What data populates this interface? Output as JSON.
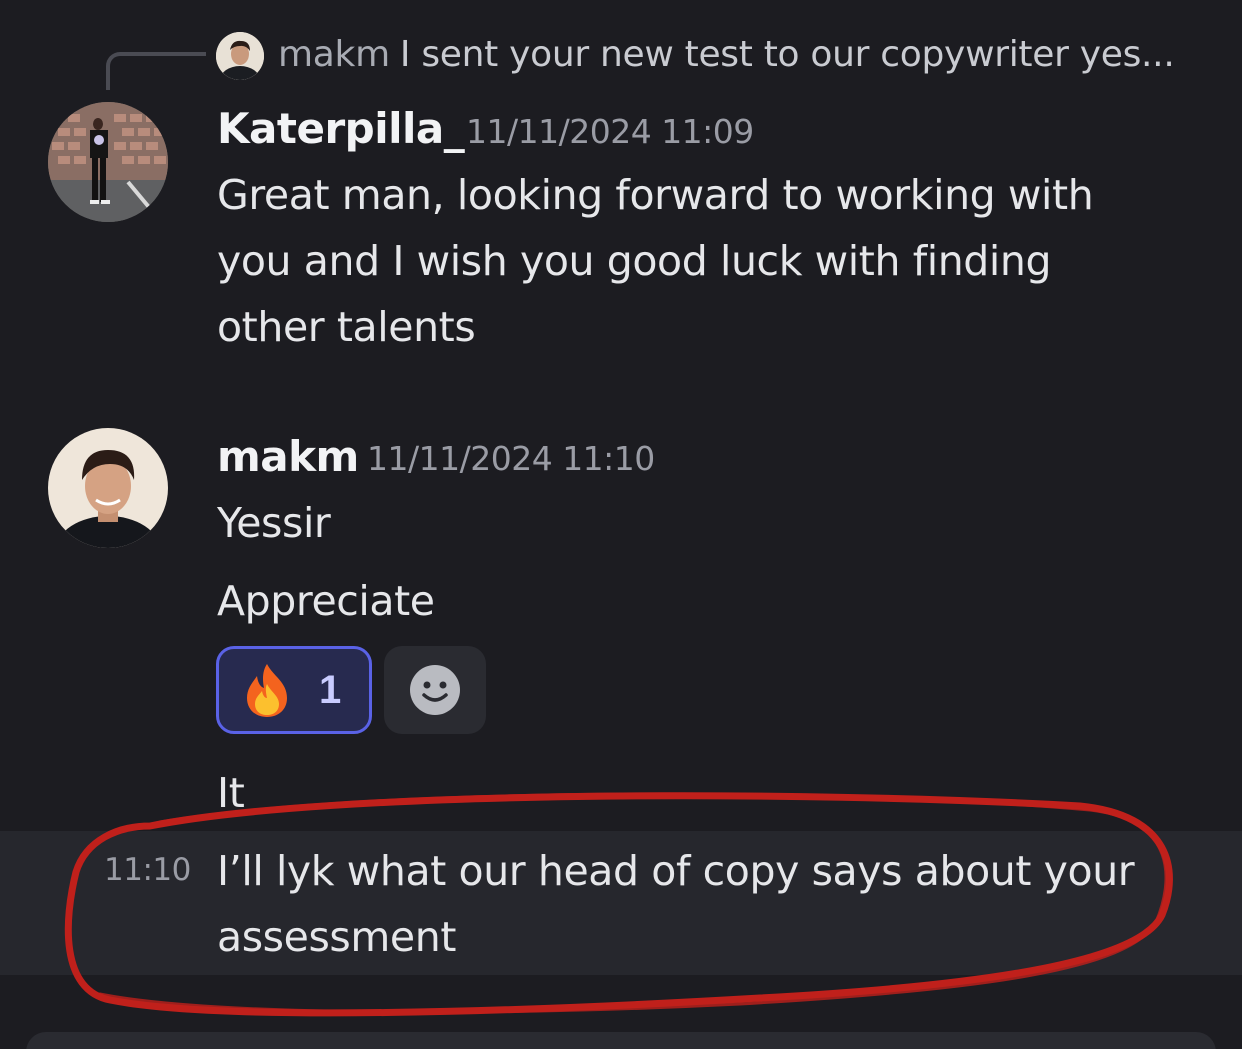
{
  "reply": {
    "author": "makm",
    "preview": "I sent your new test to our copywriter yes..."
  },
  "messages": [
    {
      "author": "Katerpilla_",
      "timestamp": "11/11/2024 11:09",
      "lines": [
        "Great man, looking forward to working with",
        "you and I wish you good luck with finding",
        "other talents"
      ]
    },
    {
      "author": "makm",
      "timestamp": "11/11/2024 11:10",
      "line1": "Yessir",
      "line2": "Appreciate",
      "reaction": {
        "emoji": "🔥",
        "count": "1"
      },
      "line3": "It"
    }
  ],
  "followup": {
    "time": "11:10",
    "lines": [
      "I’ll lyk what our head of copy says about your",
      "assessment"
    ]
  },
  "colors": {
    "background": "#1c1c21",
    "reaction_border": "#5a62e6",
    "annotation": "#c0201b"
  }
}
